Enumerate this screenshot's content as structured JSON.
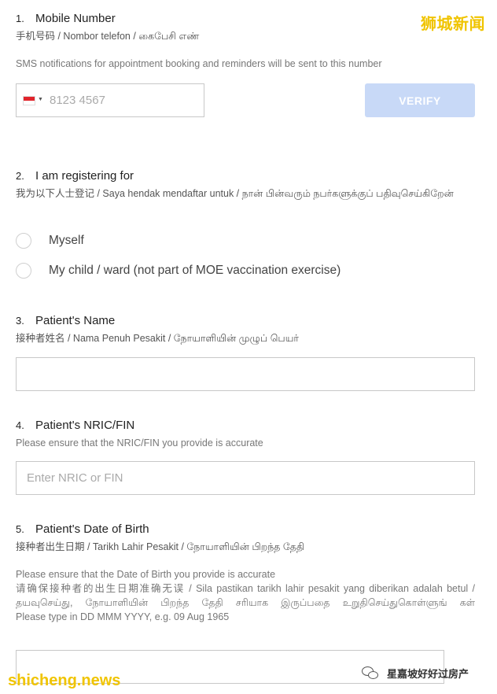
{
  "watermarks": {
    "top_right": "狮城新闻",
    "bottom_left": "shicheng.news",
    "bottom_right": "星嘉坡好好过房产"
  },
  "q1": {
    "number": "1.",
    "title": "Mobile Number",
    "subtitle": "手机号码 / Nombor telefon / கைபேசி எண்",
    "hint": "SMS notifications for appointment booking and reminders will be sent to this number",
    "phone_placeholder": "8123 4567",
    "verify_label": "VERIFY"
  },
  "q2": {
    "number": "2.",
    "title": "I am registering for",
    "subtitle": "我为以下人士登记 / Saya hendak mendaftar untuk / நான் பின்வரும் நபர்களுக்குப் பதிவுசெய்கிறேன்",
    "options": [
      {
        "label": "Myself"
      },
      {
        "label": "My child / ward (not part of MOE vaccination exercise)"
      }
    ]
  },
  "q3": {
    "number": "3.",
    "title": "Patient's Name",
    "subtitle": "接种者姓名 / Nama Penuh Pesakit / நோயாளியின் முழுப் பெயர்",
    "value": ""
  },
  "q4": {
    "number": "4.",
    "title": "Patient's NRIC/FIN",
    "hint": "Please ensure that the NRIC/FIN you provide is accurate",
    "placeholder": "Enter NRIC or FIN"
  },
  "q5": {
    "number": "5.",
    "title": "Patient's Date of Birth",
    "subtitle": "接种者出生日期 / Tarikh Lahir Pesakit / நோயாளியின் பிறந்த தேதி",
    "hint_en": "Please ensure that the Date of Birth you provide is accurate",
    "hint_multi": "请确保接种者的出生日期准确无误 / Sila pastikan tarikh lahir pesakit yang diberikan adalah betul / தயவுசெய்து, நோயாளியின் பிறந்த தேதி சரியாக இருப்பதை உறுதிசெய்துகொள்ளுங் கள்",
    "format_hint": "Please type in DD MMM YYYY, e.g. 09 Aug 1965",
    "value": ""
  }
}
